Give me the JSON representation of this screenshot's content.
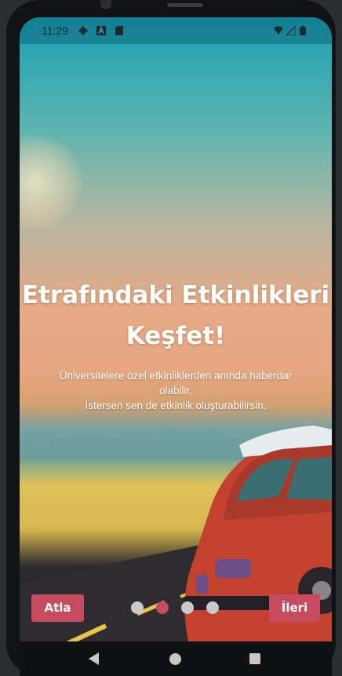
{
  "status_bar": {
    "time": "11:29",
    "icons": [
      "gear-icon",
      "a-icon",
      "sd-card-icon",
      "wifi-icon",
      "signal-icon",
      "battery-icon"
    ]
  },
  "onboarding": {
    "title_line1": "Etrafındaki Etkinlikleri",
    "title_line2": "Keşfet!",
    "description_line1": "Üniversitelere özel etkinliklerden anında haberdar",
    "description_line2": "olabilir,",
    "description_line3": "İstersen sen de etkinlik oluşturabilirsin.",
    "skip_label": "Atla",
    "next_label": "İleri",
    "page_count": 4,
    "current_page": 2
  },
  "colors": {
    "accent": "#c64b5e",
    "dot_inactive": "#c9c9c9",
    "dot_active": "#c64b5e"
  },
  "nav_bar": {
    "icons": [
      "back-icon",
      "home-icon",
      "recents-icon"
    ]
  }
}
